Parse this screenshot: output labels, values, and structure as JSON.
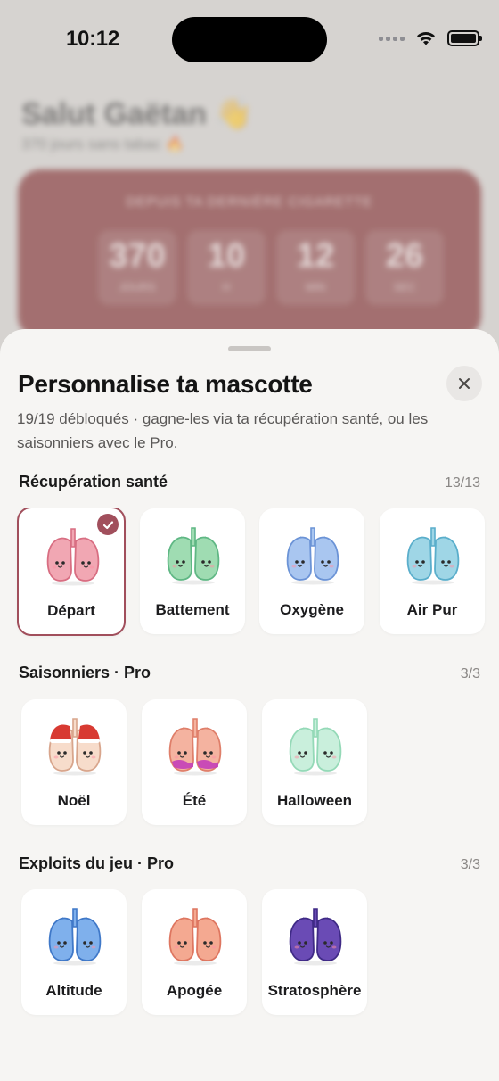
{
  "status_bar": {
    "time": "10:12"
  },
  "background": {
    "greeting": "Salut Gaëtan 👋",
    "subtitle": "370 jours sans tabac 🔥",
    "card_title": "DEPUIS TA DERNIÈRE CIGARETTE",
    "counters": [
      {
        "value": "370",
        "unit": "JOURS"
      },
      {
        "value": "10",
        "unit": "H"
      },
      {
        "value": "12",
        "unit": "MIN"
      },
      {
        "value": "26",
        "unit": "SEC"
      }
    ]
  },
  "sheet": {
    "title": "Personnalise ta mascotte",
    "description": "19/19 débloqués · gagne-les via ta récupération santé, ou les saisonniers avec le Pro.",
    "sections": [
      {
        "title": "Récupération santé",
        "count": "13/13",
        "items": [
          {
            "label": "Départ",
            "selected": true,
            "color": "#f1a7b3",
            "stroke": "#d86e82"
          },
          {
            "label": "Battement",
            "selected": false,
            "color": "#9fdcb2",
            "stroke": "#5fb784"
          },
          {
            "label": "Oxygène",
            "selected": false,
            "color": "#a9c6f0",
            "stroke": "#6b93d6"
          },
          {
            "label": "Air Pur",
            "selected": false,
            "color": "#9fd6e6",
            "stroke": "#5aaecb"
          }
        ]
      },
      {
        "title": "Saisonniers · Pro",
        "count": "3/3",
        "items": [
          {
            "label": "Noël",
            "selected": false,
            "color": "#f7dccb",
            "stroke": "#d8a58c",
            "accent": "#d83a32"
          },
          {
            "label": "Été",
            "selected": false,
            "color": "#f4b3a0",
            "stroke": "#df7f6a",
            "accent": "#c43fb8"
          },
          {
            "label": "Halloween",
            "selected": false,
            "color": "#c9efdc",
            "stroke": "#94d9b7"
          }
        ]
      },
      {
        "title": "Exploits du jeu · Pro",
        "count": "3/3",
        "items": [
          {
            "label": "Altitude",
            "selected": false,
            "color": "#7fb0ec",
            "stroke": "#3f78c8"
          },
          {
            "label": "Apogée",
            "selected": false,
            "color": "#f4a991",
            "stroke": "#de7660"
          },
          {
            "label": "Stratosphère",
            "selected": false,
            "color": "#6a4bb5",
            "stroke": "#3f2a86"
          }
        ]
      }
    ]
  }
}
